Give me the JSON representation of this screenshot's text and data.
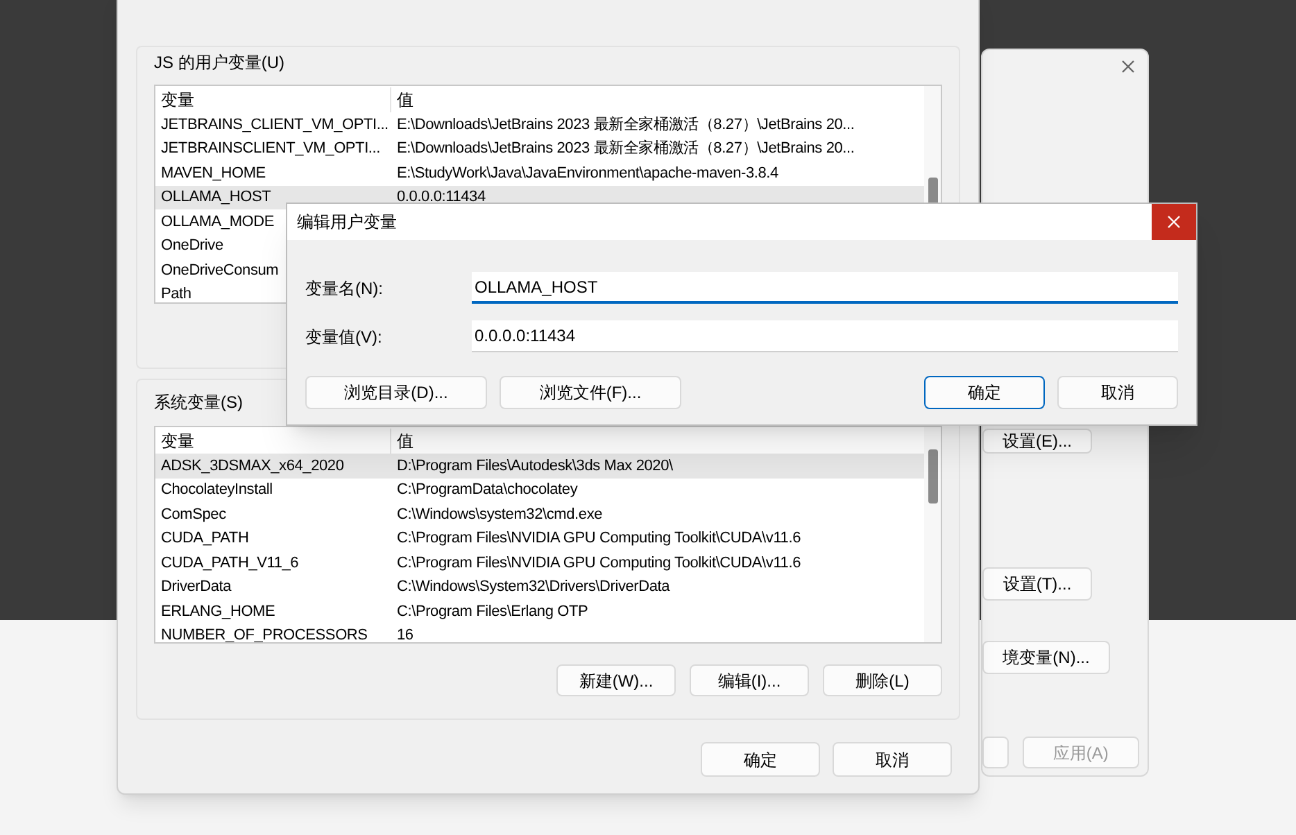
{
  "background_window": {
    "buttons": [
      {
        "label": "设置(E)...",
        "disabled": false
      },
      {
        "label": "设置(T)...",
        "disabled": false
      },
      {
        "label": "境变量(N)...",
        "disabled": false
      },
      {
        "label": "应用(A)",
        "disabled": true
      }
    ]
  },
  "environment_window": {
    "user_variables": {
      "label": "JS 的用户变量(U)",
      "columns": [
        "变量",
        "值"
      ],
      "rows": [
        {
          "name": "JETBRAINS_CLIENT_VM_OPTI...",
          "value": "E:\\Downloads\\JetBrains  2023 最新全家桶激活（8.27）\\JetBrains  20...",
          "selected": false
        },
        {
          "name": "JETBRAINSCLIENT_VM_OPTI...",
          "value": "E:\\Downloads\\JetBrains  2023 最新全家桶激活（8.27）\\JetBrains  20...",
          "selected": false
        },
        {
          "name": "MAVEN_HOME",
          "value": "E:\\StudyWork\\Java\\JavaEnvironment\\apache-maven-3.8.4",
          "selected": false
        },
        {
          "name": "OLLAMA_HOST",
          "value": "0.0.0.0:11434",
          "selected": true
        },
        {
          "name": "OLLAMA_MODE",
          "value": "",
          "selected": false
        },
        {
          "name": "OneDrive",
          "value": "",
          "selected": false
        },
        {
          "name": "OneDriveConsum",
          "value": "",
          "selected": false
        },
        {
          "name": "Path",
          "value": "",
          "selected": false
        }
      ]
    },
    "system_variables": {
      "label": "系统变量(S)",
      "columns": [
        "变量",
        "值"
      ],
      "rows": [
        {
          "name": "ADSK_3DSMAX_x64_2020",
          "value": "D:\\Program Files\\Autodesk\\3ds Max 2020\\",
          "selected": true
        },
        {
          "name": "ChocolateyInstall",
          "value": "C:\\ProgramData\\chocolatey",
          "selected": false
        },
        {
          "name": "ComSpec",
          "value": "C:\\Windows\\system32\\cmd.exe",
          "selected": false
        },
        {
          "name": "CUDA_PATH",
          "value": "C:\\Program Files\\NVIDIA GPU Computing Toolkit\\CUDA\\v11.6",
          "selected": false
        },
        {
          "name": "CUDA_PATH_V11_6",
          "value": "C:\\Program Files\\NVIDIA GPU Computing Toolkit\\CUDA\\v11.6",
          "selected": false
        },
        {
          "name": "DriverData",
          "value": "C:\\Windows\\System32\\Drivers\\DriverData",
          "selected": false
        },
        {
          "name": "ERLANG_HOME",
          "value": "C:\\Program Files\\Erlang OTP",
          "selected": false
        },
        {
          "name": "NUMBER_OF_PROCESSORS",
          "value": "16",
          "selected": false
        }
      ],
      "buttons": [
        "新建(W)...",
        "编辑(I)...",
        "删除(L)"
      ]
    },
    "buttons": [
      "确定",
      "取消"
    ]
  },
  "edit_dialog": {
    "title": "编辑用户变量",
    "fields": [
      {
        "label": "变量名(N):",
        "value": "OLLAMA_HOST",
        "focused": true
      },
      {
        "label": "变量值(V):",
        "value": "0.0.0.0:11434",
        "focused": false
      }
    ],
    "buttons": [
      {
        "label": "浏览目录(D)...",
        "default": false
      },
      {
        "label": "浏览文件(F)...",
        "default": false
      },
      {
        "label": "确定",
        "default": true
      },
      {
        "label": "取消",
        "default": false
      }
    ]
  }
}
